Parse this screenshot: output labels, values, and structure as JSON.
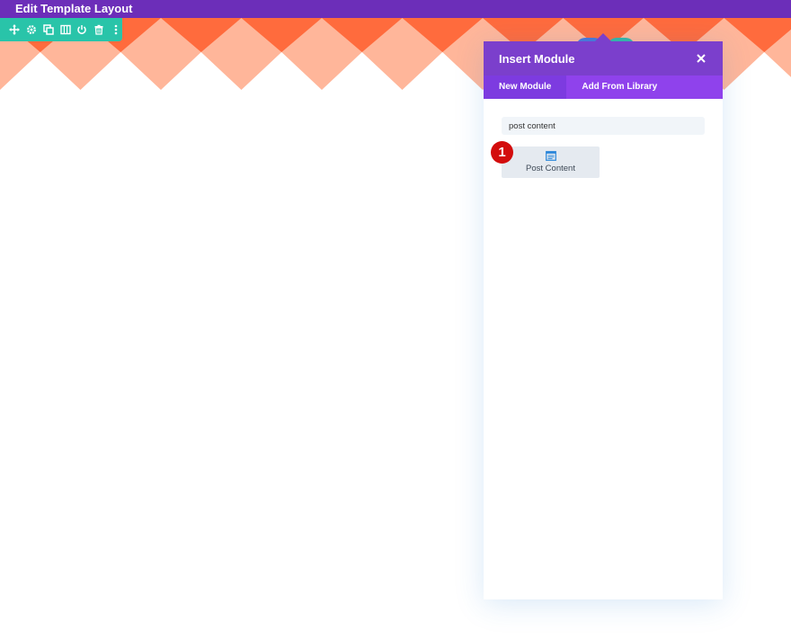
{
  "topbar": {
    "title": "Edit Template Layout"
  },
  "section_toolbar": {
    "icons": [
      "move-icon",
      "settings-icon",
      "duplicate-icon",
      "columns-icon",
      "power-icon",
      "trash-icon",
      "more-icon"
    ],
    "color": "#29c4a9"
  },
  "modal": {
    "title": "Insert Module",
    "close_icon": "close-icon",
    "tabs": [
      {
        "label": "New Module",
        "active": true
      },
      {
        "label": "Add From Library",
        "active": false
      }
    ],
    "search": {
      "value": "post content",
      "placeholder": ""
    },
    "modules": [
      {
        "label": "Post Content",
        "icon": "post-content-icon"
      }
    ]
  },
  "step_marker": {
    "label": "1"
  },
  "colors": {
    "topbar": "#6c2eb9",
    "modal_header": "#7b3fcc",
    "tabs": "#8f42ec",
    "banner_dark": "#ff6b3d",
    "banner_light": "#ffb69a",
    "step_marker": "#d30d0d"
  }
}
